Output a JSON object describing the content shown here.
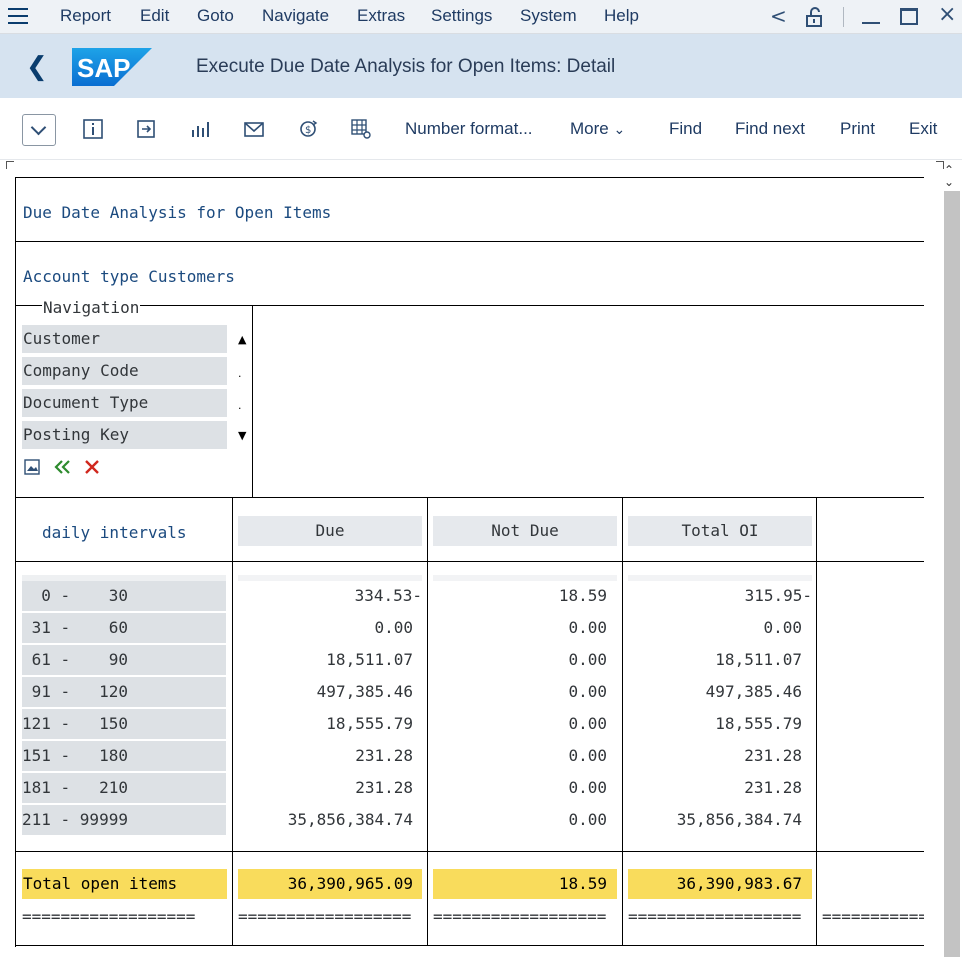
{
  "menu": {
    "items": [
      "Report",
      "Edit",
      "Goto",
      "Navigate",
      "Extras",
      "Settings",
      "System",
      "Help"
    ]
  },
  "window_controls": {
    "back": "<",
    "minimize": "—",
    "maximize": "□",
    "close": "×"
  },
  "title_bar": {
    "logo_text": "SAP",
    "title": "Execute Due Date Analysis for Open Items: Detail"
  },
  "toolbar": {
    "number_format": "Number format...",
    "more": "More",
    "find": "Find",
    "find_next": "Find next",
    "print": "Print",
    "exit": "Exit"
  },
  "report": {
    "title": "Due Date Analysis for Open Items",
    "account_type": "Account type Customers",
    "navigation_label": "Navigation",
    "navigation_items": [
      "Customer",
      "Company Code",
      "Document Type",
      "Posting Key"
    ],
    "columns": {
      "interval": "daily intervals",
      "due": "Due",
      "not_due": "Not Due",
      "total": "Total OI"
    },
    "rows": [
      {
        "interval": "  0 -    30",
        "due": "334.53-",
        "not_due": "18.59",
        "total": "315.95-"
      },
      {
        "interval": " 31 -    60",
        "due": "0.00",
        "not_due": "0.00",
        "total": "0.00"
      },
      {
        "interval": " 61 -    90",
        "due": "18,511.07",
        "not_due": "0.00",
        "total": "18,511.07"
      },
      {
        "interval": " 91 -   120",
        "due": "497,385.46",
        "not_due": "0.00",
        "total": "497,385.46"
      },
      {
        "interval": "121 -   150",
        "due": "18,555.79",
        "not_due": "0.00",
        "total": "18,555.79"
      },
      {
        "interval": "151 -   180",
        "due": "231.28",
        "not_due": "0.00",
        "total": "231.28"
      },
      {
        "interval": "181 -   210",
        "due": "231.28",
        "not_due": "0.00",
        "total": "231.28"
      },
      {
        "interval": "211 - 99999",
        "due": "35,856,384.74",
        "not_due": "0.00",
        "total": "35,856,384.74"
      }
    ],
    "totals": {
      "label": "Total open items",
      "due": "36,390,965.09",
      "not_due": "18.59",
      "total": "36,390,983.67"
    },
    "separator": "=================="
  },
  "colors": {
    "total_highlight": "#f9dc5c",
    "title_bar": "#d6e3f0",
    "nav_item_bg": "#dde1e5"
  }
}
